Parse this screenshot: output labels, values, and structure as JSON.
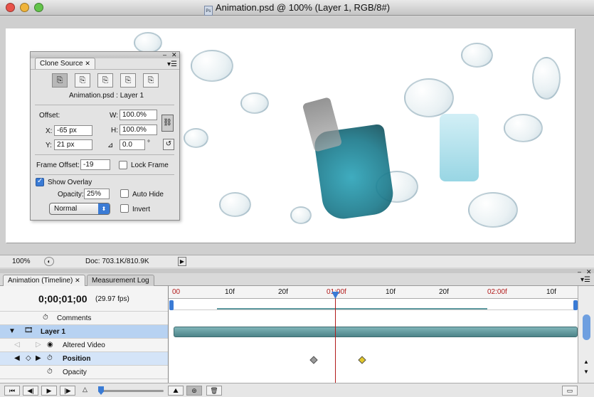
{
  "window": {
    "title": "Animation.psd @ 100% (Layer 1, RGB/8#)"
  },
  "status": {
    "zoom": "100%",
    "doc": "Doc: 703.1K/810.9K"
  },
  "clone_panel": {
    "tab": "Clone Source",
    "source_name": "Animation.psd : Layer 1",
    "offset_label": "Offset:",
    "x_label": "X:",
    "x_value": "-65 px",
    "y_label": "Y:",
    "y_value": "21 px",
    "w_label": "W:",
    "w_value": "100.0%",
    "h_label": "H:",
    "h_value": "100.0%",
    "angle_value": "0.0",
    "angle_unit": "°",
    "frame_offset_label": "Frame Offset:",
    "frame_offset_value": "-19",
    "lock_frame": "Lock Frame",
    "show_overlay": "Show Overlay",
    "opacity_label": "Opacity:",
    "opacity_value": "25%",
    "auto_hide": "Auto Hide",
    "blend_mode": "Normal",
    "invert": "Invert"
  },
  "timeline": {
    "tabs": [
      "Animation (Timeline)",
      "Measurement Log"
    ],
    "timecode": "0;00;01;00",
    "fps": "(29.97 fps)",
    "ruler": [
      "00",
      "10f",
      "20f",
      "01:00f",
      "10f",
      "20f",
      "02:00f",
      "10f"
    ],
    "rows": {
      "comments": "Comments",
      "layer": "Layer 1",
      "altered": "Altered Video",
      "position": "Position",
      "opacity": "Opacity"
    }
  },
  "colors": {
    "accent": "#3a7bd5",
    "layer_bar": "#5f9aa0",
    "keyframe_selected": "#e3c82a",
    "playhead": "#b21b1b"
  }
}
